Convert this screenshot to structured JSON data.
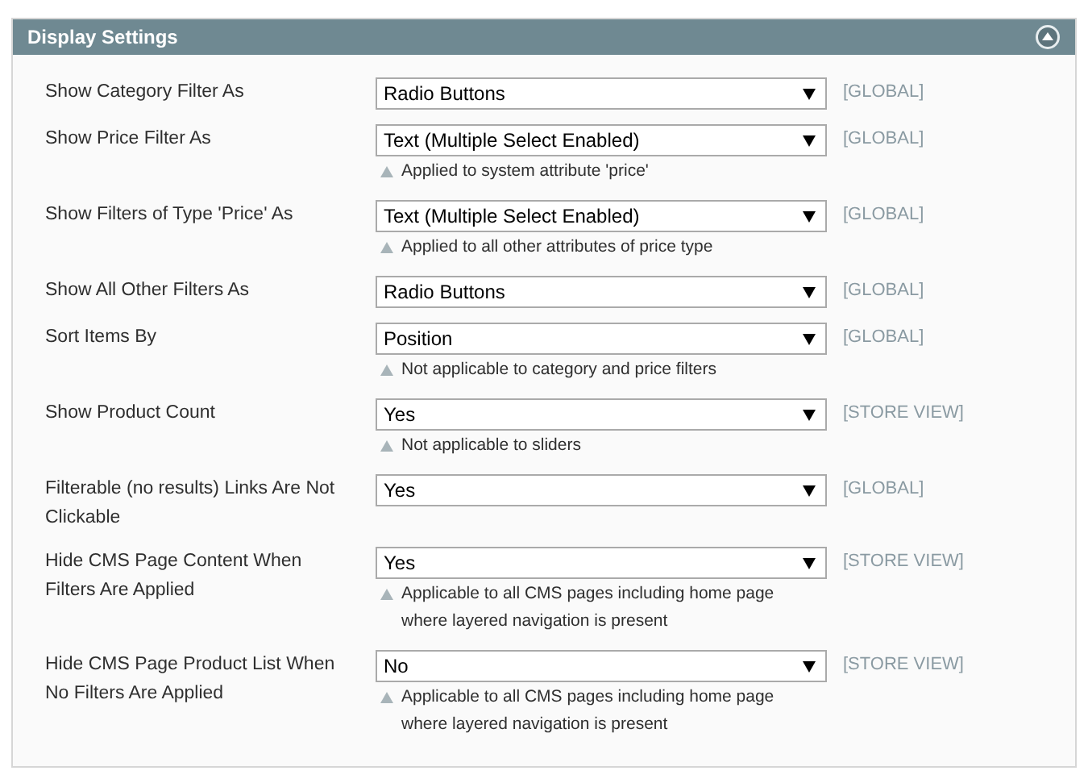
{
  "section": {
    "title": "Display Settings",
    "expanded": true
  },
  "fields": [
    {
      "label": "Show Category Filter As",
      "value": "Radio Buttons",
      "scope": "[GLOBAL]"
    },
    {
      "label": "Show Price Filter As",
      "value": "Text (Multiple Select Enabled)",
      "scope": "[GLOBAL]",
      "note": "Applied to system attribute 'price'"
    },
    {
      "label": "Show Filters of Type 'Price' As",
      "value": "Text (Multiple Select Enabled)",
      "scope": "[GLOBAL]",
      "note": "Applied to all other attributes of price type"
    },
    {
      "label": "Show All Other Filters As",
      "value": "Radio Buttons",
      "scope": "[GLOBAL]"
    },
    {
      "label": "Sort Items By",
      "value": "Position",
      "scope": "[GLOBAL]",
      "note": "Not applicable to category and price filters"
    },
    {
      "label": "Show Product Count",
      "value": "Yes",
      "scope": "[STORE VIEW]",
      "note": "Not applicable to sliders"
    },
    {
      "label": "Filterable (no results) Links Are Not Clickable",
      "value": "Yes",
      "scope": "[GLOBAL]"
    },
    {
      "label": "Hide CMS Page Content When Filters Are Applied",
      "value": "Yes",
      "scope": "[STORE VIEW]",
      "note": "Applicable to all CMS pages including home page where layered navigation is present"
    },
    {
      "label": "Hide CMS Page Product List When No Filters Are Applied",
      "value": "No",
      "scope": "[STORE VIEW]",
      "note": "Applicable to all CMS pages including home page where layered navigation is present"
    }
  ]
}
